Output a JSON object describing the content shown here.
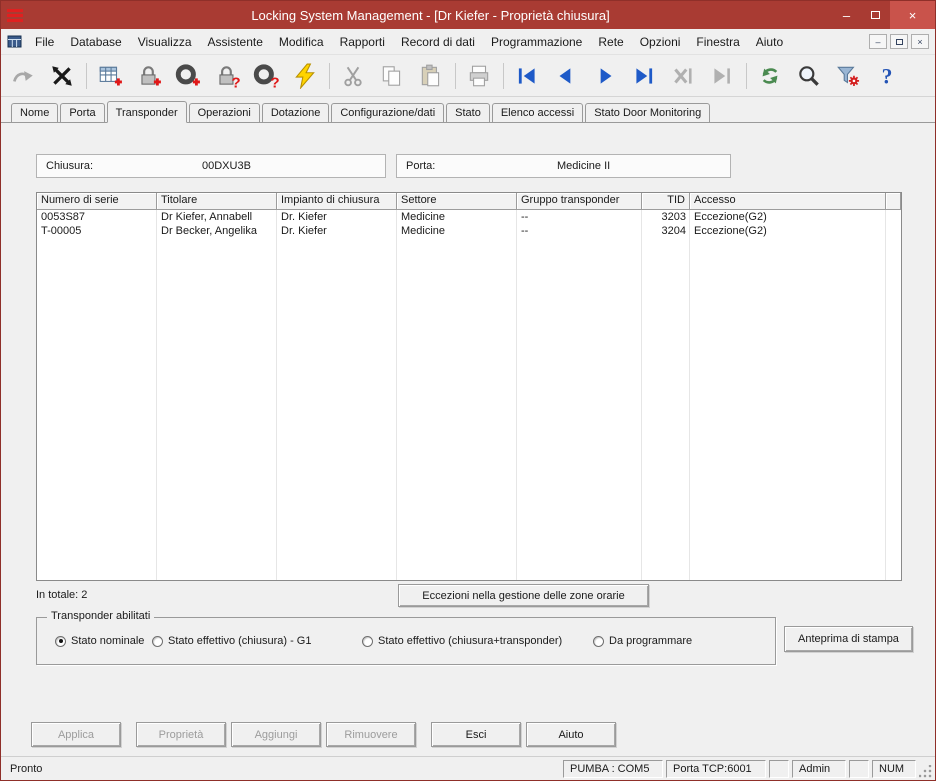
{
  "window": {
    "title": "Locking System Management - [Dr Kiefer - Proprietà chiusura]",
    "controls": [
      "minimize",
      "maximize",
      "close"
    ]
  },
  "menu": {
    "items": [
      "File",
      "Database",
      "Visualizza",
      "Assistente",
      "Modifica",
      "Rapporti",
      "Record di dati",
      "Programmazione",
      "Rete",
      "Opzioni",
      "Finestra",
      "Aiuto"
    ]
  },
  "toolbar": {
    "icons": [
      {
        "name": "transfer-icon",
        "enabled": false
      },
      {
        "name": "network-task-icon",
        "enabled": true
      },
      {
        "name": "new-locking-system-icon",
        "enabled": true
      },
      {
        "name": "new-lock-icon",
        "enabled": true
      },
      {
        "name": "new-transponder-icon",
        "enabled": true
      },
      {
        "name": "read-lock-icon",
        "enabled": true
      },
      {
        "name": "read-transponder-icon",
        "enabled": true
      },
      {
        "name": "program-icon",
        "enabled": true
      },
      {
        "name": "cut-icon",
        "enabled": false
      },
      {
        "name": "copy-icon",
        "enabled": false
      },
      {
        "name": "paste-icon",
        "enabled": false
      },
      {
        "name": "print-icon",
        "enabled": false
      },
      {
        "name": "first-record-icon",
        "enabled": true
      },
      {
        "name": "previous-record-icon",
        "enabled": true
      },
      {
        "name": "next-record-icon",
        "enabled": true
      },
      {
        "name": "last-record-icon",
        "enabled": true
      },
      {
        "name": "cancel-record-icon",
        "enabled": false
      },
      {
        "name": "skip-record-icon",
        "enabled": false
      },
      {
        "name": "refresh-icon",
        "enabled": true
      },
      {
        "name": "search-icon",
        "enabled": true
      },
      {
        "name": "filter-settings-icon",
        "enabled": true
      },
      {
        "name": "help-icon",
        "enabled": true
      }
    ]
  },
  "tabs": {
    "items": [
      {
        "label": "Nome",
        "active": false
      },
      {
        "label": "Porta",
        "active": false
      },
      {
        "label": "Transponder",
        "active": true
      },
      {
        "label": "Operazioni",
        "active": false
      },
      {
        "label": "Dotazione",
        "active": false
      },
      {
        "label": "Configurazione/dati",
        "active": false
      },
      {
        "label": "Stato",
        "active": false
      },
      {
        "label": "Elenco accessi",
        "active": false
      },
      {
        "label": "Stato Door Monitoring",
        "active": false
      }
    ]
  },
  "fields": {
    "lock_label": "Chiusura:",
    "lock_value": "00DXU3B",
    "door_label": "Porta:",
    "door_value": "Medicine II"
  },
  "table": {
    "columns": [
      "Numero di serie",
      "Titolare",
      "Impianto di chiusura",
      "Settore",
      "Gruppo transponder",
      "TID",
      "Accesso",
      ""
    ],
    "rows": [
      [
        "0053S87",
        "Dr Kiefer, Annabell",
        "Dr. Kiefer",
        "Medicine",
        "--",
        "3203",
        "Eccezione(G2)"
      ],
      [
        "T-00005",
        "Dr Becker, Angelika",
        "Dr. Kiefer",
        "Medicine",
        "--",
        "3204",
        "Eccezione(G2)"
      ]
    ],
    "total": "In totale: 2"
  },
  "actions": {
    "exceptions_button": "Eccezioni nella gestione delle zone orarie",
    "print_preview_button": "Anteprima di stampa"
  },
  "filter_group": {
    "legend": "Transponder abilitati",
    "options": [
      {
        "label": "Stato nominale",
        "selected": true
      },
      {
        "label": "Stato effettivo (chiusura) - G1",
        "selected": false
      },
      {
        "label": "Stato effettivo (chiusura+transponder)",
        "selected": false
      },
      {
        "label": "Da programmare",
        "selected": false
      }
    ]
  },
  "footer_buttons": [
    {
      "label": "Applica",
      "disabled": true
    },
    {
      "label": "Proprietà",
      "disabled": true
    },
    {
      "label": "Aggiungi",
      "disabled": true
    },
    {
      "label": "Rimuovere",
      "disabled": true
    },
    {
      "label": "Esci",
      "disabled": false
    },
    {
      "label": "Aiuto",
      "disabled": false
    }
  ],
  "statusbar": {
    "ready": "Pronto",
    "cells": [
      "PUMBA : COM5",
      "Porta TCP:6001",
      "",
      "Admin",
      "",
      "NUM"
    ]
  }
}
